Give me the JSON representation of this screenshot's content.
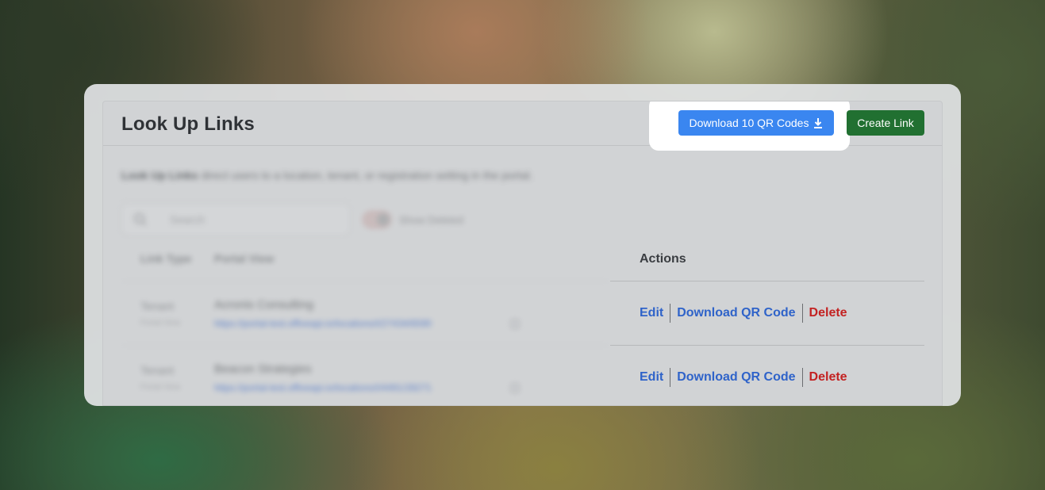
{
  "header": {
    "title": "Look Up Links",
    "download_all_label": "Download 10 QR Codes",
    "create_label": "Create Link"
  },
  "description": {
    "bold": "Look Up Links",
    "text": " direct users to a location, tenant, or registration setting in the portal."
  },
  "filters": {
    "search_placeholder": "Search",
    "toggle_label": "Show Deleted"
  },
  "table": {
    "columns": [
      "Link Type",
      "Portal View",
      "Actions"
    ],
    "rows": [
      {
        "type": "Tenant",
        "type_sub": "Portal View",
        "name": "Acronis Consulting",
        "url": "https://portal-test.offiveapi.io/locations/t/27434/6590",
        "actions": {
          "edit": "Edit",
          "download": "Download QR Code",
          "delete": "Delete"
        }
      },
      {
        "type": "Tenant",
        "type_sub": "Portal View",
        "name": "Beacon Strategies",
        "url": "https://portal-test.offiveapi.io/locations/t/4491/28271",
        "actions": {
          "edit": "Edit",
          "download": "Download QR Code",
          "delete": "Delete"
        }
      }
    ]
  },
  "colors": {
    "primary": "#3a86f0",
    "create": "#217031",
    "link": "#2f63c9",
    "danger": "#c32222"
  }
}
